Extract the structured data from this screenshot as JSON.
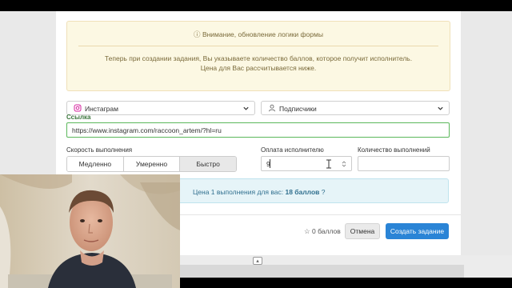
{
  "alert": {
    "heading": "Внимание, обновление логики формы",
    "line1": "Теперь при создании задания, Вы указываете количество баллов, которое получит исполнитель.",
    "line2": "Цена для Вас рассчитывается ниже."
  },
  "selects": {
    "platform": "Инстаграм",
    "service": "Подписчики"
  },
  "link": {
    "label": "Ссылка",
    "value": "https://www.instagram.com/raccoon_artem/?hl=ru"
  },
  "speed": {
    "label": "Скорость выполнения",
    "options": [
      "Медленно",
      "Умеренно",
      "Быстро"
    ],
    "selected": "Быстро"
  },
  "payment": {
    "label": "Оплата исполнителю",
    "value": "9"
  },
  "count": {
    "label": "Количество выполнений",
    "value": ""
  },
  "price": {
    "prefix": "Цена 1 выполнения для вас:",
    "value": "18 баллов"
  },
  "footer": {
    "points": "0 баллов",
    "cancel": "Отмена",
    "create": "Создать задание"
  },
  "colors": {
    "primary": "#2a84d6",
    "alert_bg": "#fcf8e3",
    "info_bg": "#e6f4f8",
    "link_border": "#5cb85c"
  }
}
